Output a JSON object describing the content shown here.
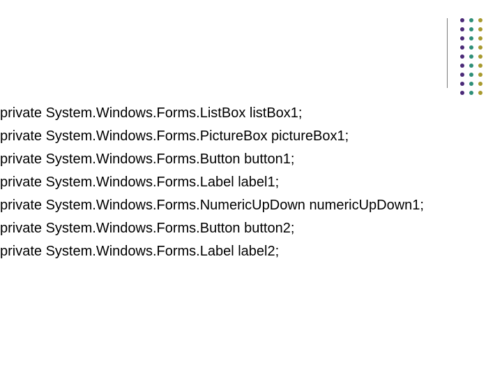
{
  "code": {
    "lines": [
      "private System.Windows.Forms.ListBox listBox1;",
      "private System.Windows.Forms.PictureBox pictureBox1;",
      "private System.Windows.Forms.Button button1;",
      "private System.Windows.Forms.Label label1;",
      "private System.Windows.Forms.NumericUpDown numericUpDown1;",
      "private System.Windows.Forms.Button button2;",
      "private System.Windows.Forms.Label label2;"
    ]
  }
}
